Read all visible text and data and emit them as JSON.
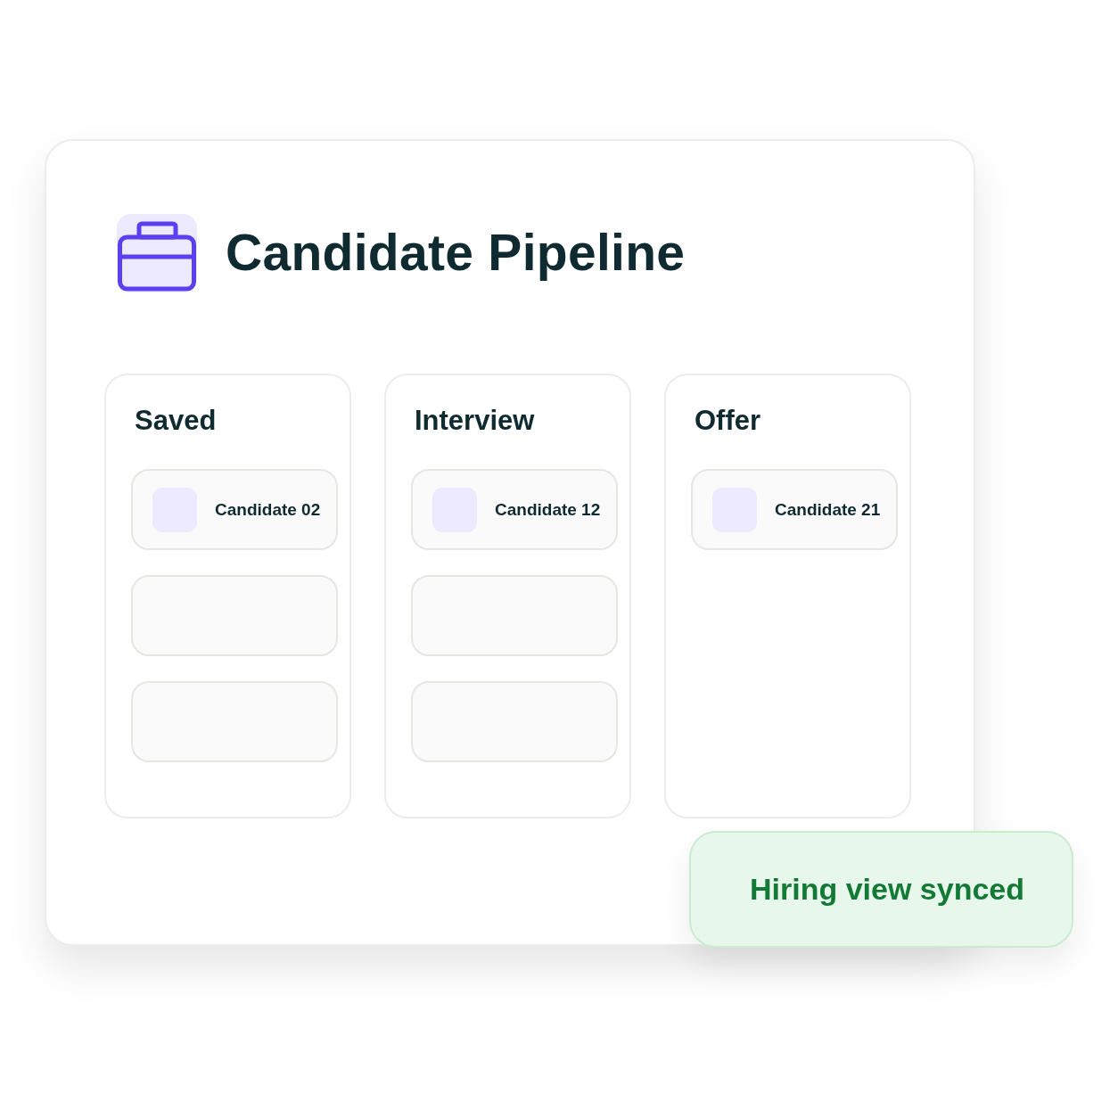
{
  "header": {
    "title": "Candidate Pipeline"
  },
  "columns": [
    {
      "name": "Saved",
      "cards": [
        {
          "kind": "candidate",
          "name": "Candidate 02"
        },
        {
          "kind": "placeholder"
        },
        {
          "kind": "placeholder"
        }
      ]
    },
    {
      "name": "Interview",
      "cards": [
        {
          "kind": "candidate",
          "name": "Candidate 12"
        },
        {
          "kind": "placeholder"
        },
        {
          "kind": "placeholder"
        }
      ]
    },
    {
      "name": "Offer",
      "cards": [
        {
          "kind": "candidate",
          "name": "Candidate 21"
        }
      ]
    }
  ],
  "toast": {
    "message": "Hiring view synced"
  }
}
